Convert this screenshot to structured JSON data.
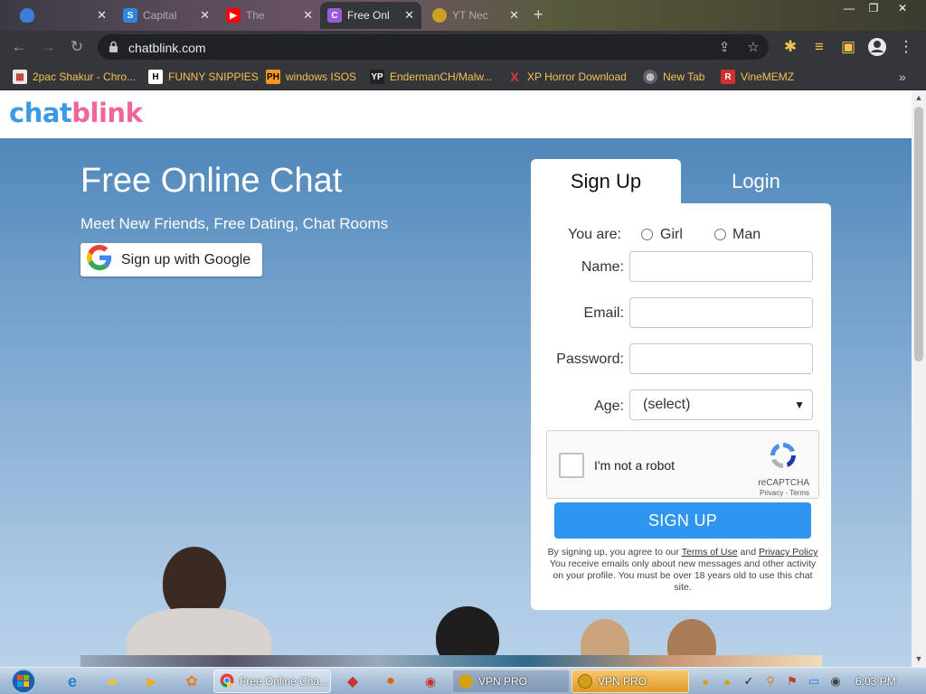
{
  "browser": {
    "tabs": [
      {
        "title": "",
        "icon": "shield-icon",
        "color": "#3b7dd8"
      },
      {
        "title": "Capital",
        "icon": "s-icon",
        "color": "#2e86de"
      },
      {
        "title": "The",
        "icon": "youtube-icon",
        "color": "#ff0000"
      },
      {
        "title": "Free Onl",
        "icon": "chatblink-icon",
        "color": "#9c5bd6"
      },
      {
        "title": "YT Nec",
        "icon": "coin-icon",
        "color": "#c9a227"
      }
    ],
    "url": "chatblink.com",
    "bookmarks": [
      {
        "label": "2pac Shakur - Chro...",
        "icon": "calendar-icon"
      },
      {
        "label": "FUNNY SNIPPIES",
        "icon": "h-icon"
      },
      {
        "label": "windows ISOS",
        "icon": "ph-icon"
      },
      {
        "label": "EndermanCH/Malw...",
        "icon": "yp-icon"
      },
      {
        "label": "XP Horror Download",
        "icon": "x-icon"
      },
      {
        "label": "New Tab",
        "icon": "globe-icon"
      },
      {
        "label": "VineMEMZ",
        "icon": "r-icon"
      }
    ],
    "bookmarks_more": "»"
  },
  "site": {
    "logo_part1": "chat",
    "logo_part2": "blink",
    "hero_title": "Free Online Chat",
    "hero_subtitle": "Meet New Friends, Free Dating, Chat Rooms",
    "google_button": "Sign up with Google"
  },
  "form": {
    "tab_signup": "Sign Up",
    "tab_login": "Login",
    "you_are_label": "You are:",
    "gender_options": [
      "Girl",
      "Man"
    ],
    "name_label": "Name:",
    "email_label": "Email:",
    "password_label": "Password:",
    "age_label": "Age:",
    "age_value": "(select)",
    "captcha_text": "I'm not a robot",
    "captcha_brand": "reCAPTCHA",
    "captcha_links": "Privacy - Terms",
    "submit": "SIGN UP",
    "terms_pre": "By signing up, you agree to our ",
    "terms_link": "Terms of Use",
    "terms_and": " and ",
    "privacy_link": "Privacy Policy",
    "terms_post": " You receive emails only about new messages and other activity on your profile. You must be over 18 years old to use this chat site."
  },
  "taskbar": {
    "tasks": [
      "Free Online Cha...",
      "VPN PRO",
      "VPN PRO"
    ],
    "clock": "6:03 PM"
  },
  "colors": {
    "logo_blue": "#3b9ae6",
    "logo_pink": "#f0669b",
    "signup_button": "#2f96f0",
    "bookmark_text": "#f1c152"
  }
}
